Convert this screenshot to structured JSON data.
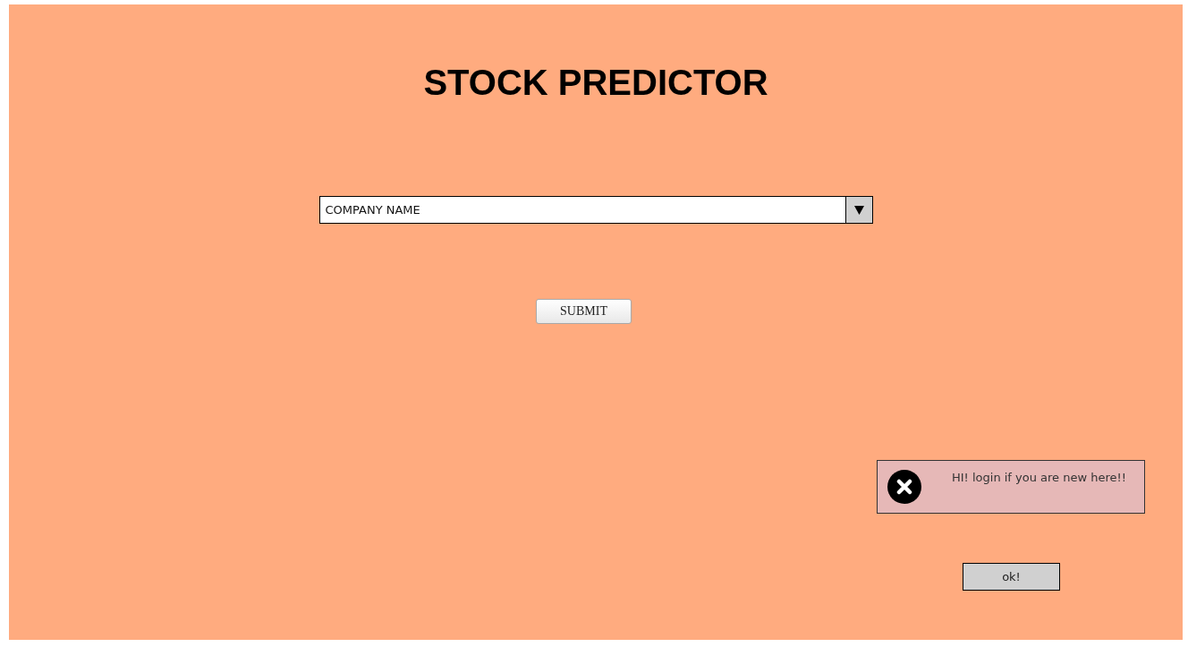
{
  "title": "STOCK PREDICTOR",
  "company_select": {
    "value": "COMPANY NAME"
  },
  "submit_button": {
    "label": "SUBMIT"
  },
  "alert": {
    "message": "HI! login if you are new here!!"
  },
  "ok_button": {
    "label": "ok!"
  }
}
